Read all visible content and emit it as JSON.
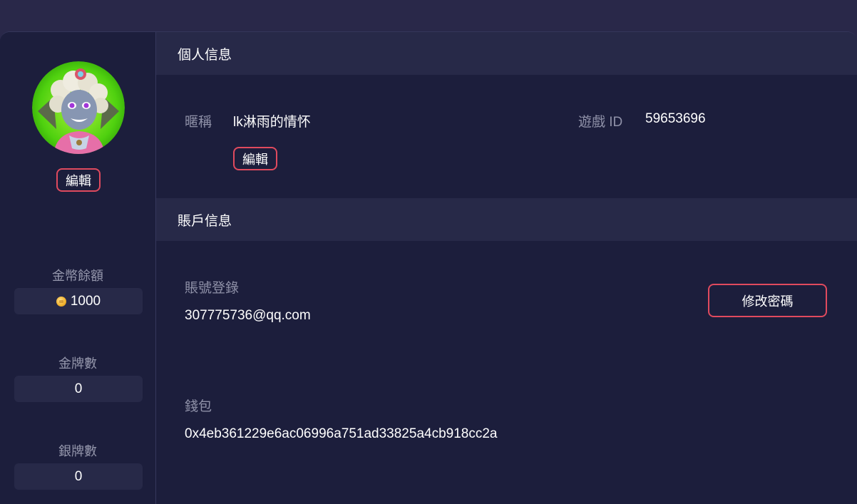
{
  "sidebar": {
    "avatar_alt": "avatar",
    "edit_label": "編輯",
    "stats": [
      {
        "label": "金幣餘額",
        "value": "1000",
        "icon": "coin-icon"
      },
      {
        "label": "金牌數",
        "value": "0"
      },
      {
        "label": "銀牌數",
        "value": "0"
      }
    ]
  },
  "personal": {
    "title": "個人信息",
    "nickname_label": "暱稱",
    "nickname_value": "lk淋雨的情怀",
    "edit_label": "編輯",
    "game_id_label": "遊戲 ID",
    "game_id_value": "59653696"
  },
  "account": {
    "title": "賬戶信息",
    "login_label": "賬號登錄",
    "login_value": "307775736@qq.com",
    "change_password_label": "修改密碼",
    "wallet_label": "錢包",
    "wallet_value": "0x4eb361229e6ac06996a751ad33825a4cb918cc2a"
  },
  "colors": {
    "accent_border": "#e04a5e",
    "panel_bg": "#1c1e3c",
    "header_bg": "#272948",
    "page_bg": "#292849"
  }
}
